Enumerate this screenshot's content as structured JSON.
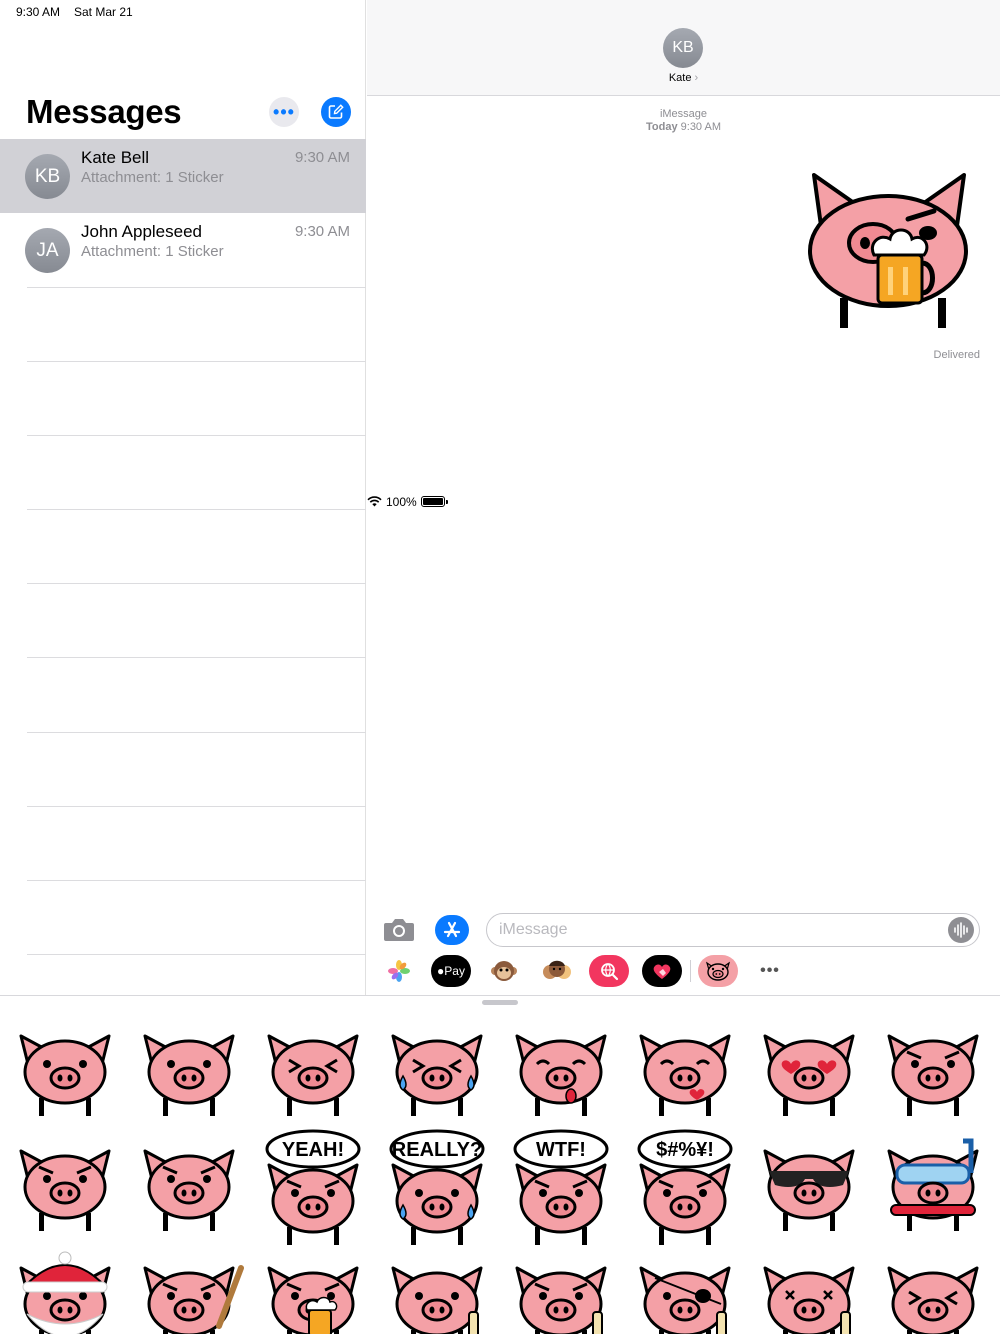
{
  "status_bar": {
    "time": "9:30 AM",
    "date": "Sat Mar 21",
    "battery": "100%"
  },
  "sidebar": {
    "title": "Messages",
    "more_label": "•••",
    "conversations": [
      {
        "initials": "KB",
        "name": "Kate Bell",
        "preview": "Attachment: 1 Sticker",
        "time": "9:30 AM",
        "selected": true
      },
      {
        "initials": "JA",
        "name": "John Appleseed",
        "preview": "Attachment: 1 Sticker",
        "time": "9:30 AM",
        "selected": false
      }
    ]
  },
  "conversation": {
    "contact_initials": "KB",
    "contact_name": "Kate",
    "service": "iMessage",
    "timestamp_day": "Today",
    "timestamp_time": "9:30 AM",
    "delivery_status": "Delivered"
  },
  "composer": {
    "placeholder": "iMessage"
  },
  "app_strip": {
    "items": [
      "photos-app",
      "apple-pay",
      "animoji",
      "memoji",
      "web-images-search",
      "digital-touch",
      "pig-stickers-app",
      "more-apps"
    ],
    "apple_pay_label": "Pay",
    "more_label": "•••"
  },
  "sticker_drawer": {
    "stickers": [
      "pig-neutral",
      "pig-smile",
      "pig-grumpy",
      "pig-crying-laugh",
      "pig-tongue-out",
      "pig-kiss",
      "pig-heart-eyes",
      "pig-happy",
      "pig-angry",
      "pig-angry-2",
      "pig-yeah",
      "pig-really",
      "pig-wtf",
      "pig-swearing",
      "pig-sunglasses",
      "pig-snorkel",
      "pig-santa",
      "pig-baseball-bat",
      "pig-beer",
      "pig-bottle",
      "pig-drinking",
      "pig-pirate",
      "pig-dizzy",
      "pig-squint"
    ],
    "speech": {
      "yeah": "YEAH!",
      "really": "REALLY?",
      "wtf": "WTF!",
      "swear": "$#%¥!"
    }
  },
  "colors": {
    "accent": "#0a7aff",
    "pig_pink": "#f4a0a6",
    "selected_row": "#d1d1d6",
    "secondary_text": "#8e8e93"
  }
}
